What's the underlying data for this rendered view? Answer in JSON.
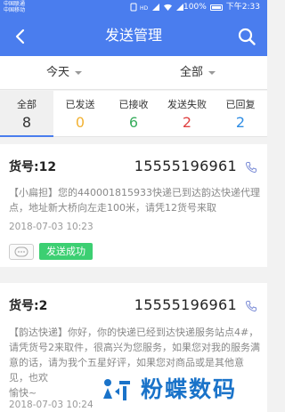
{
  "statusbar": {
    "carrier_1": "中国联通",
    "carrier_2": "中国移动",
    "network_icons": [
      "sim-icon",
      "hd-icon",
      "signal-icon",
      "wifi-icon",
      "signal-icon"
    ],
    "battery": "100%",
    "time": "下午2:33"
  },
  "header": {
    "title": "发送管理",
    "back_icon": "chevron-left-icon",
    "search_icon": "search-icon"
  },
  "filters": {
    "date": "今天",
    "scope": "全部"
  },
  "tabs": [
    {
      "label": "全部",
      "count": "8",
      "color": "#333333",
      "active": true
    },
    {
      "label": "已发送",
      "count": "0",
      "color": "#f2b233",
      "active": false
    },
    {
      "label": "已接收",
      "count": "6",
      "color": "#3aae5f",
      "active": false
    },
    {
      "label": "发送失败",
      "count": "2",
      "color": "#e04343",
      "active": false
    },
    {
      "label": "已回复",
      "count": "2",
      "color": "#2f8de4",
      "active": false
    }
  ],
  "messages": [
    {
      "tracking": "货号:12",
      "phone": "15555196961",
      "tag": "【小扁担】",
      "body": "您的440001815933快递已到达韵达快递代理点，地址新大桥向左走100米，请凭12货号来取",
      "time": "2018-07-03 10:23",
      "status": "发送成功"
    },
    {
      "tracking": "货号:2",
      "phone": "15555196961",
      "tag": "【韵达快递】",
      "body": "你好，你的快递已经到达快递服务站点4#，请凭货号2来取件，很高兴为您服务，如果您对我的服务满意的话，请为我个五星好评，如果您对商品或是其他意见，也欢",
      "body_tail": "愉快~",
      "time": "2018-07-03 10:24"
    }
  ],
  "watermark": {
    "text": "粉蝶数码"
  },
  "colors": {
    "primary": "#4a7dee",
    "success": "#3ccf72",
    "watermark": "#1a73c9"
  }
}
